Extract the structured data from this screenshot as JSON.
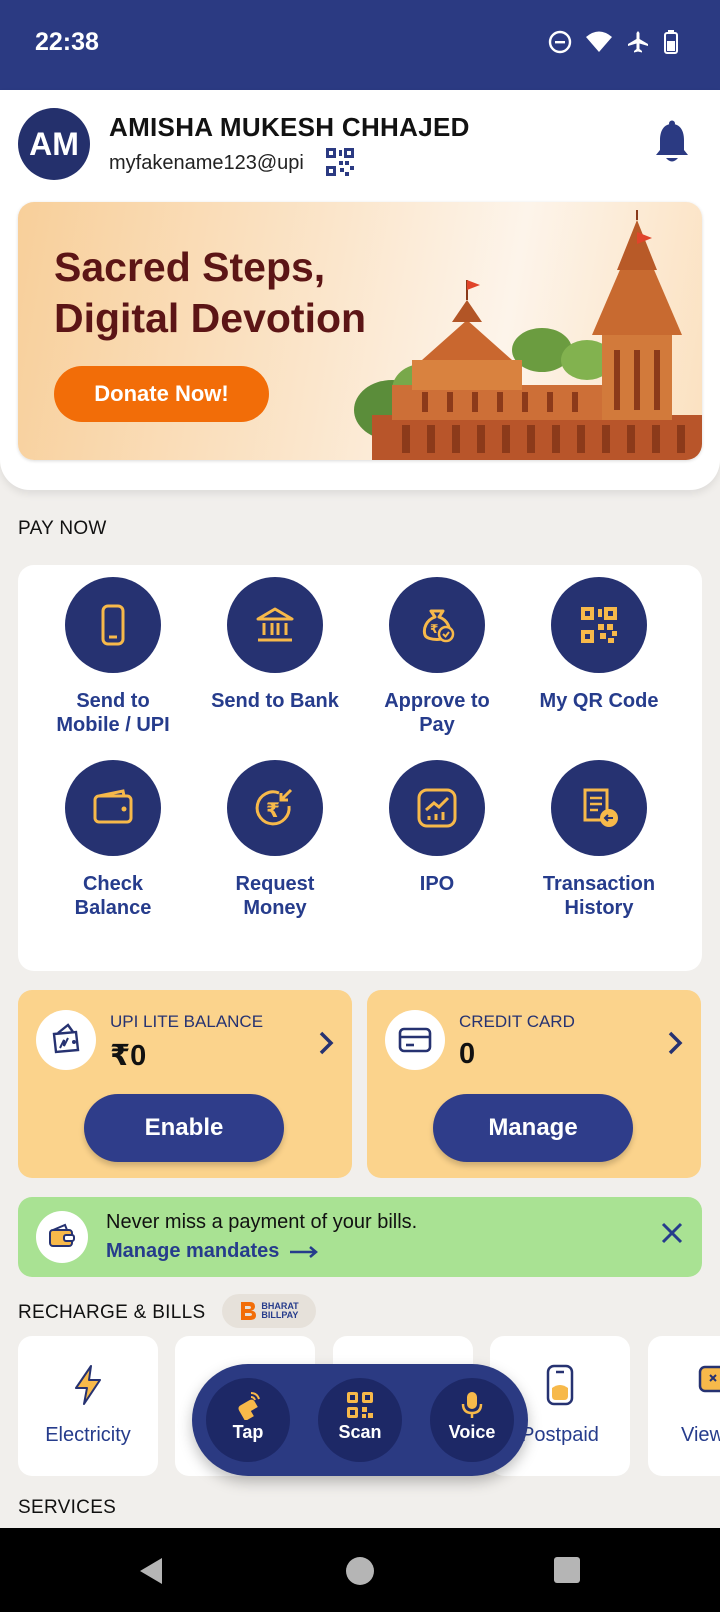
{
  "status_bar": {
    "time": "22:38"
  },
  "profile": {
    "initials": "AM",
    "name": "AMISHA MUKESH CHHAJED",
    "upi_id": "myfakename123@upi"
  },
  "banner": {
    "line1": "Sacred Steps,",
    "line2": "Digital Devotion",
    "cta": "Donate Now!"
  },
  "pay_now": {
    "heading": "PAY NOW",
    "items": [
      {
        "line1": "Send to",
        "line2": "Mobile / UPI",
        "icon": "mobile-icon"
      },
      {
        "line1": "Send to Bank",
        "line2": "",
        "icon": "bank-icon"
      },
      {
        "line1": "Approve to",
        "line2": "Pay",
        "icon": "money-bag-check-icon"
      },
      {
        "line1": "My QR Code",
        "line2": "",
        "icon": "qr-code-icon"
      },
      {
        "line1": "Check",
        "line2": "Balance",
        "icon": "wallet-icon"
      },
      {
        "line1": "Request",
        "line2": "Money",
        "icon": "rupee-request-icon"
      },
      {
        "line1": "IPO",
        "line2": "",
        "icon": "chart-icon"
      },
      {
        "line1": "Transaction",
        "line2": "History",
        "icon": "receipt-history-icon"
      }
    ]
  },
  "upi_lite": {
    "label": "UPI LITE BALANCE",
    "amount": "₹0",
    "button": "Enable"
  },
  "credit_card": {
    "label": "CREDIT CARD",
    "amount": "0",
    "button": "Manage"
  },
  "mandate": {
    "message": "Never miss a payment of your bills.",
    "link": "Manage mandates"
  },
  "recharge": {
    "heading": "RECHARGE & BILLS",
    "bbps_line1": "BHARAT",
    "bbps_line2": "BILLPAY",
    "tiles": [
      {
        "label": "Electricity"
      },
      {
        "label": ""
      },
      {
        "label": ""
      },
      {
        "label": "Postpaid"
      },
      {
        "label": "View"
      }
    ]
  },
  "fab": {
    "tap": "Tap",
    "scan": "Scan",
    "voice": "Voice"
  },
  "services": {
    "heading": "SERVICES"
  },
  "colors": {
    "brand": "#2b3a82",
    "accent_orange": "#f26d08",
    "card_yellow": "#fbd38c",
    "mandate_green": "#a9e293"
  }
}
